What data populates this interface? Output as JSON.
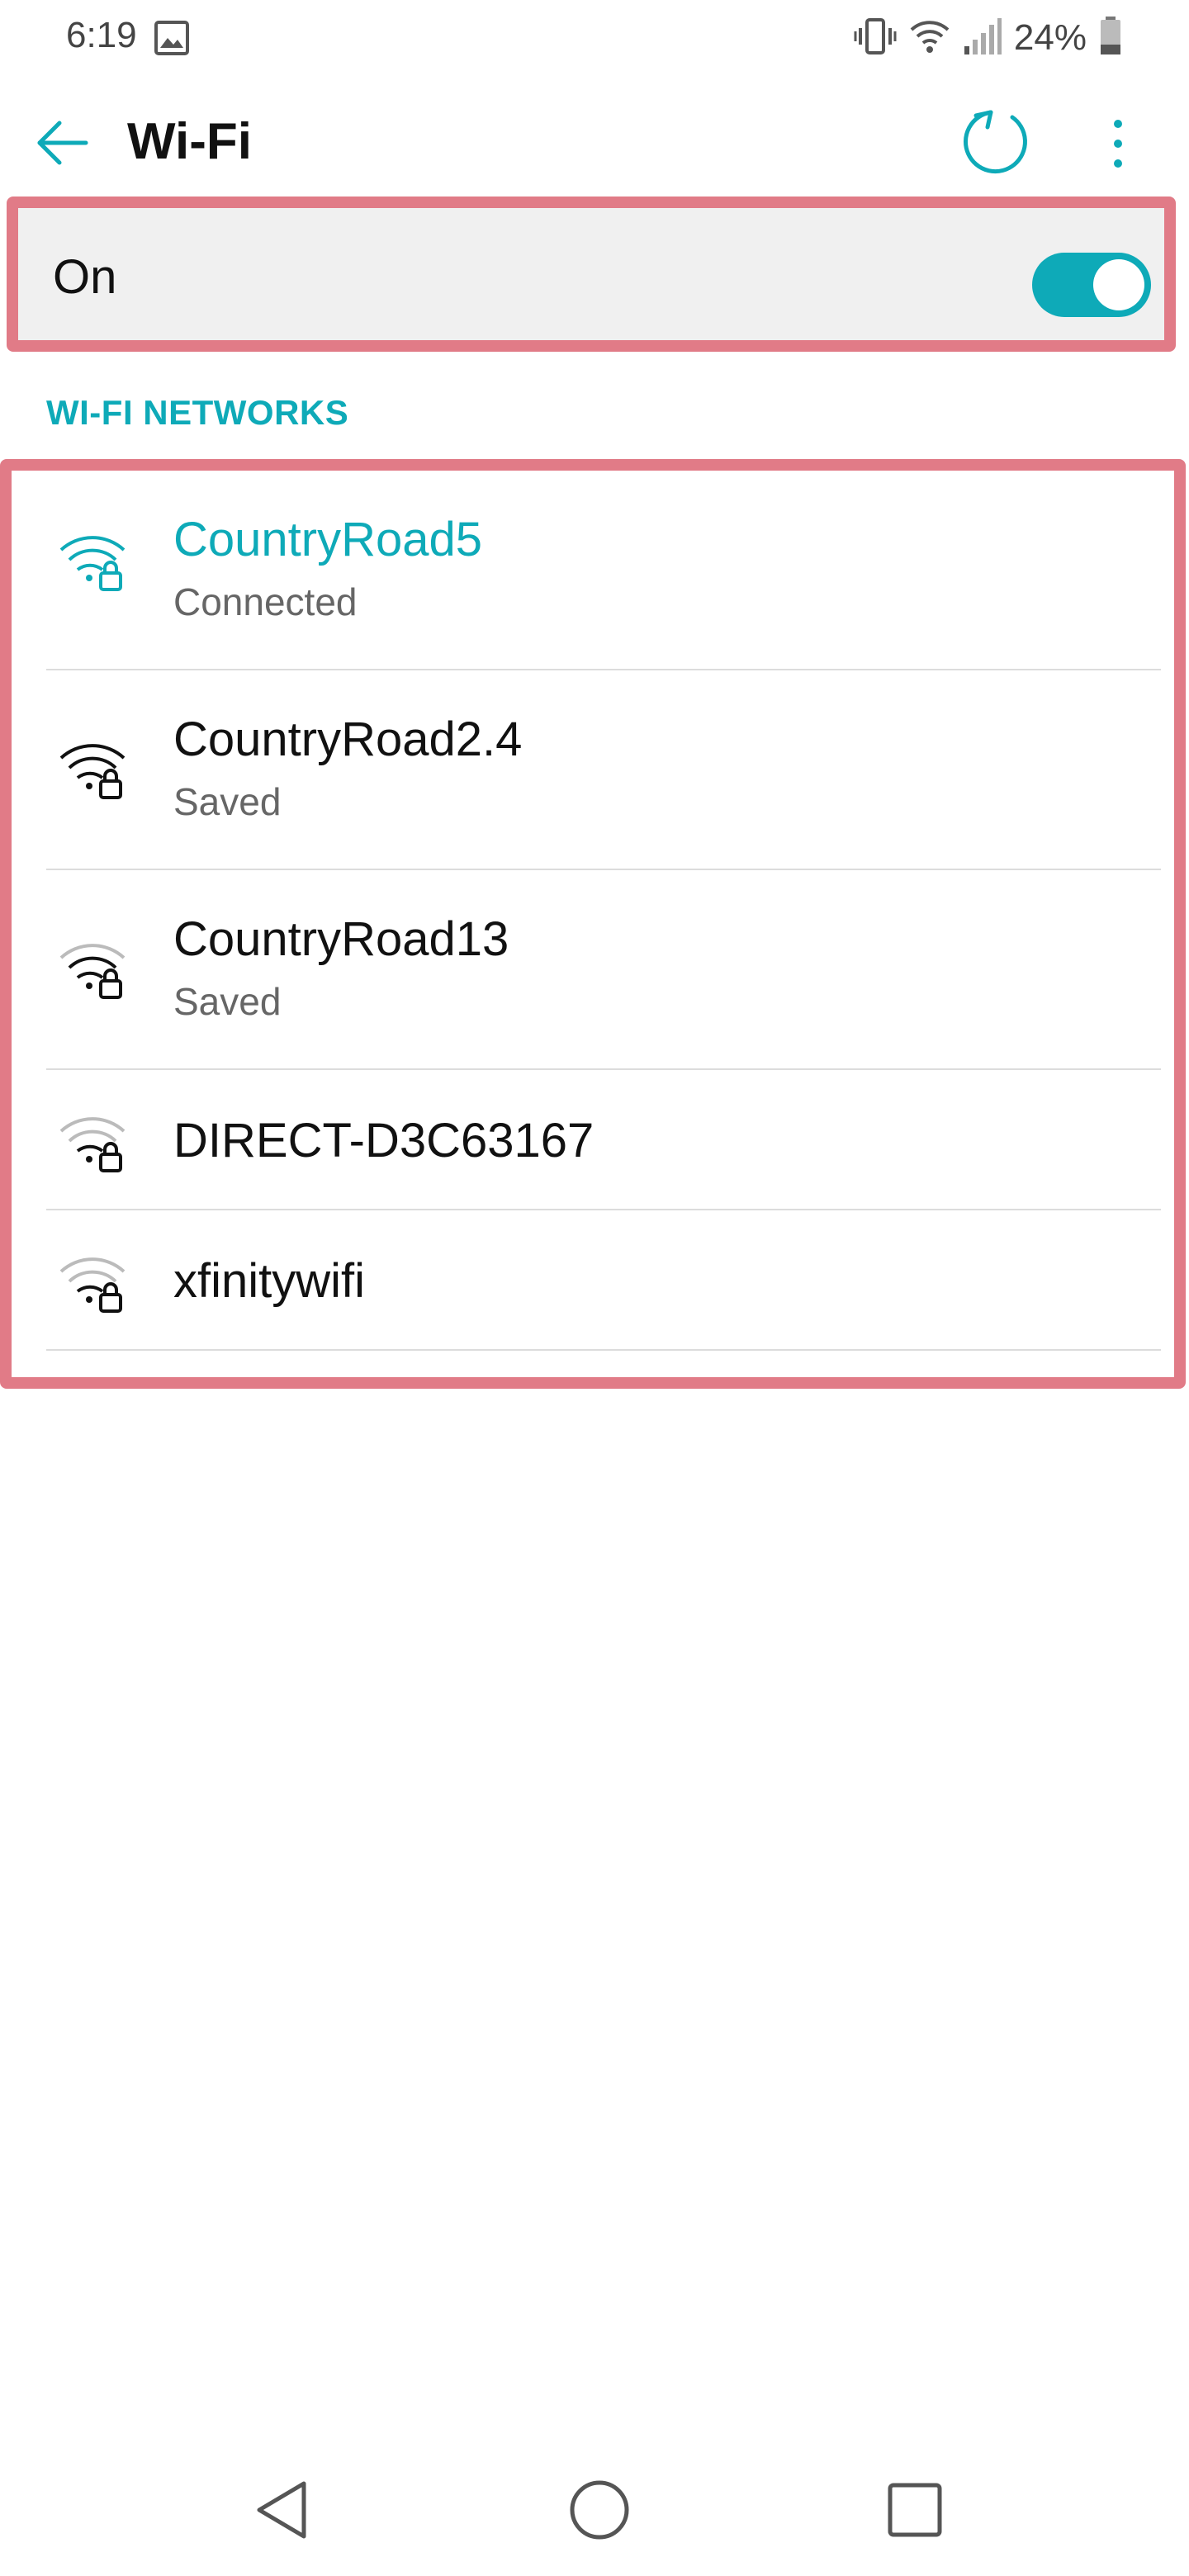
{
  "status_bar": {
    "time": "6:19",
    "battery": "24%",
    "icons": [
      "image-icon",
      "vibrate-icon",
      "wifi-status-icon",
      "cell-signal-icon",
      "battery-icon"
    ]
  },
  "toolbar": {
    "title": "Wi-Fi",
    "icons": [
      "back-arrow-icon",
      "refresh-icon",
      "more-vert-icon"
    ]
  },
  "wifi_toggle": {
    "label": "On",
    "state": "on"
  },
  "section_header": "WI-FI NETWORKS",
  "networks": [
    {
      "name": "CountryRoad5",
      "status": "Connected",
      "active": true,
      "signal": "full"
    },
    {
      "name": "CountryRoad2.4",
      "status": "Saved",
      "active": false,
      "signal": "strong"
    },
    {
      "name": "CountryRoad13",
      "status": "Saved",
      "active": false,
      "signal": "medium"
    },
    {
      "name": "DIRECT-D3C63167",
      "status": "",
      "active": false,
      "signal": "weak"
    },
    {
      "name": "xfinitywifi",
      "status": "",
      "active": false,
      "signal": "weak"
    }
  ],
  "colors": {
    "accent": "#0eaab8",
    "highlight_border": "#e17b87",
    "toggle_row_bg": "#f0f0f0"
  },
  "nav_bar": {
    "icons": [
      "back-triangle-icon",
      "home-circle-icon",
      "recents-square-icon"
    ]
  }
}
